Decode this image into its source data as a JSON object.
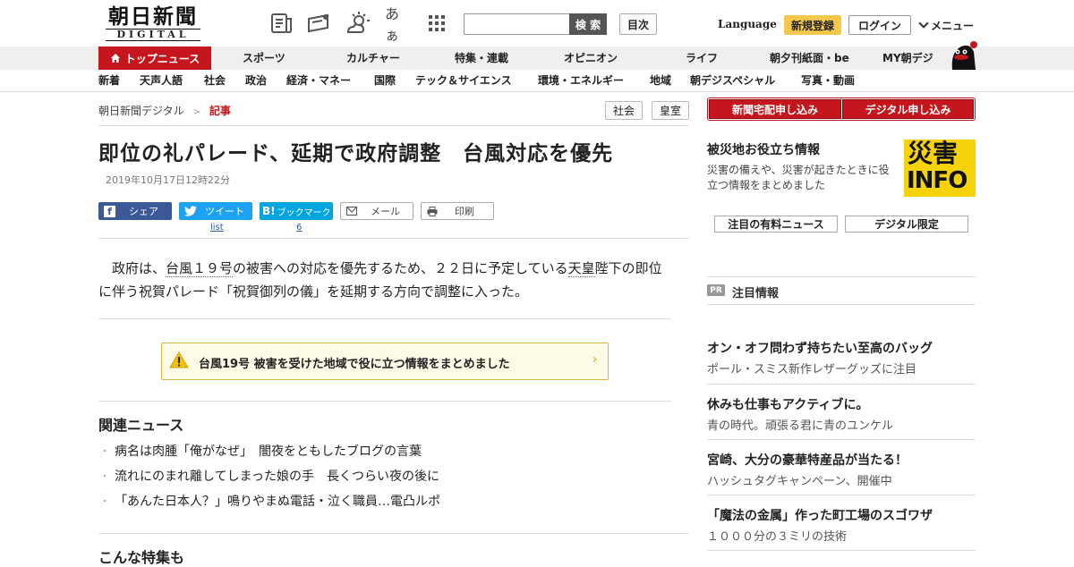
{
  "header": {
    "logo_top": "朝日新聞",
    "logo_bottom": "DIGITAL",
    "kana_icon_text": "あぁ",
    "search_placeholder": "",
    "search_button": "検 索",
    "toc_button": "目次",
    "language": "Language",
    "register": "新規登録",
    "login": "ログイン",
    "menu": "メニュー"
  },
  "nav_primary": {
    "top_news": "トップニュース",
    "items": [
      "スポーツ",
      "カルチャー",
      "特集・連載",
      "オピニオン",
      "ライフ",
      "朝夕刊紙面・be",
      "MY朝デジ"
    ]
  },
  "nav_secondary": {
    "items": [
      "新着",
      "天声人語",
      "社会",
      "政治",
      "経済・マネー",
      "国際",
      "テック＆サイエンス",
      "環境・エネルギー",
      "地域",
      "朝デジスペシャル",
      "写真・動画"
    ]
  },
  "breadcrumb": {
    "home": "朝日新聞デジタル",
    "separator": ">",
    "current": "記事"
  },
  "tags": [
    "社会",
    "皇室"
  ],
  "article": {
    "title": "即位の礼パレード、延期で政府調整　台風対応を優先",
    "date": "2019年10月17日12時22分",
    "share": {
      "facebook": "シェア",
      "twitter": "ツイート",
      "twitter_count": "list",
      "hatena": "ブックマーク",
      "hatena_count": "6",
      "mail": "メール",
      "print": "印刷"
    },
    "lead_a": "　政府は、",
    "lead_link1": "台風１９号",
    "lead_b": "の被害への対応を優先するため、２２日に予定している",
    "lead_link2": "天皇",
    "lead_c": "陛下の即位に伴う祝賀パレード「祝賀御列の儀」を延期する方向で調整に入った。",
    "alert": "台風19号 被害を受けた地域で役に立つ情報をまとめました",
    "alert_chevron": "›"
  },
  "related": {
    "heading": "関連ニュース",
    "items": [
      "病名は肉腫「俺がなぜ」　闇夜をともしたブログの言葉",
      "流れにのまれ離してしまった娘の手　長くつらい夜の後に",
      "「あんた日本人？」鳴りやまぬ電話・泣く職員…電凸ルポ"
    ],
    "bullet": "・"
  },
  "feature_heading": "こんな特集も",
  "sidebar": {
    "subscribe_paper": "新聞宅配申し込み",
    "subscribe_digital": "デジタル申し込み",
    "disaster_title": "被災地お役立ち情報",
    "disaster_desc": "災害の備えや、災害が起きたときに役立つ情報をまとめました",
    "info_top": "災害",
    "info_bottom": "INFO",
    "paid_news": "注目の有料ニュース",
    "digital_only": "デジタル限定",
    "pr_badge": "PR",
    "pr_label": "注目情報",
    "ads": [
      {
        "title": "オン・オフ問わず持ちたい至高のバッグ",
        "desc": "ポール・スミス新作レザーグッズに注目"
      },
      {
        "title": "休みも仕事もアクティブに。",
        "desc": "青の時代。頑張る君に青のユンケル"
      },
      {
        "title": "宮崎、大分の豪華特産品が当たる！",
        "desc": "ハッシュタグキャンペーン、開催中"
      },
      {
        "title": "「魔法の金属」作った町工場のスゴワザ",
        "desc": "１０００分の３ミリの技術"
      }
    ]
  },
  "colors": {
    "brand_red": "#c4161c",
    "register_yellow": "#f5c84c",
    "twitter": "#1da1f2",
    "facebook": "#3b5998",
    "hatena": "#00a4de",
    "alert_bg": "#fdfbe6"
  }
}
